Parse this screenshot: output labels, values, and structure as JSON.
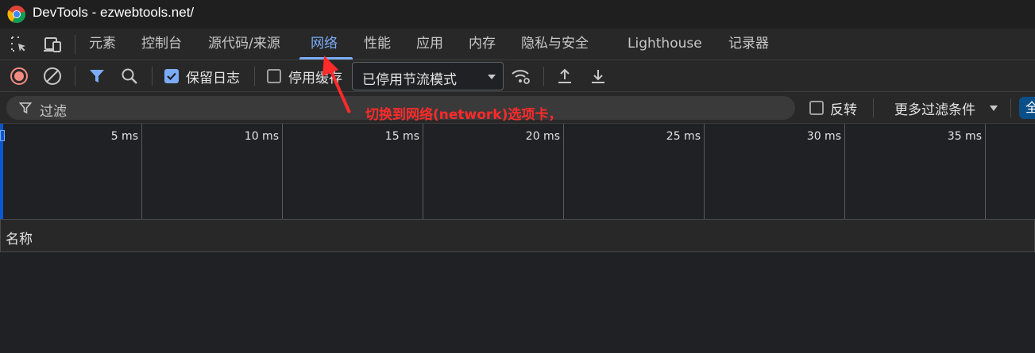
{
  "window": {
    "title": "DevTools - ezwebtools.net/"
  },
  "tabs": [
    {
      "label": "元素"
    },
    {
      "label": "控制台"
    },
    {
      "label": "源代码/来源"
    },
    {
      "label": "网络",
      "active": true
    },
    {
      "label": "性能"
    },
    {
      "label": "应用"
    },
    {
      "label": "内存"
    },
    {
      "label": "隐私与安全"
    },
    {
      "label": "Lighthouse"
    },
    {
      "label": "记录器"
    }
  ],
  "toolbar": {
    "preserve_log_label": "保留日志",
    "preserve_log_checked": true,
    "disable_cache_label": "停用缓存",
    "disable_cache_checked": false,
    "throttling_value": "已停用节流模式"
  },
  "filter": {
    "placeholder": "过滤",
    "invert_label": "反转",
    "invert_checked": false,
    "more_filters_label": "更多过滤条件",
    "all_chip_label": "全"
  },
  "timeline": {
    "ticks": [
      "5 ms",
      "10 ms",
      "15 ms",
      "20 ms",
      "25 ms",
      "30 ms",
      "35 ms"
    ]
  },
  "table": {
    "name_column": "名称"
  },
  "annotation": {
    "text": "切换到网络(network)选项卡，"
  },
  "colors": {
    "accent": "#7cacf8",
    "annotation_red": "#ff2a2a",
    "record_red": "#f28b82"
  }
}
